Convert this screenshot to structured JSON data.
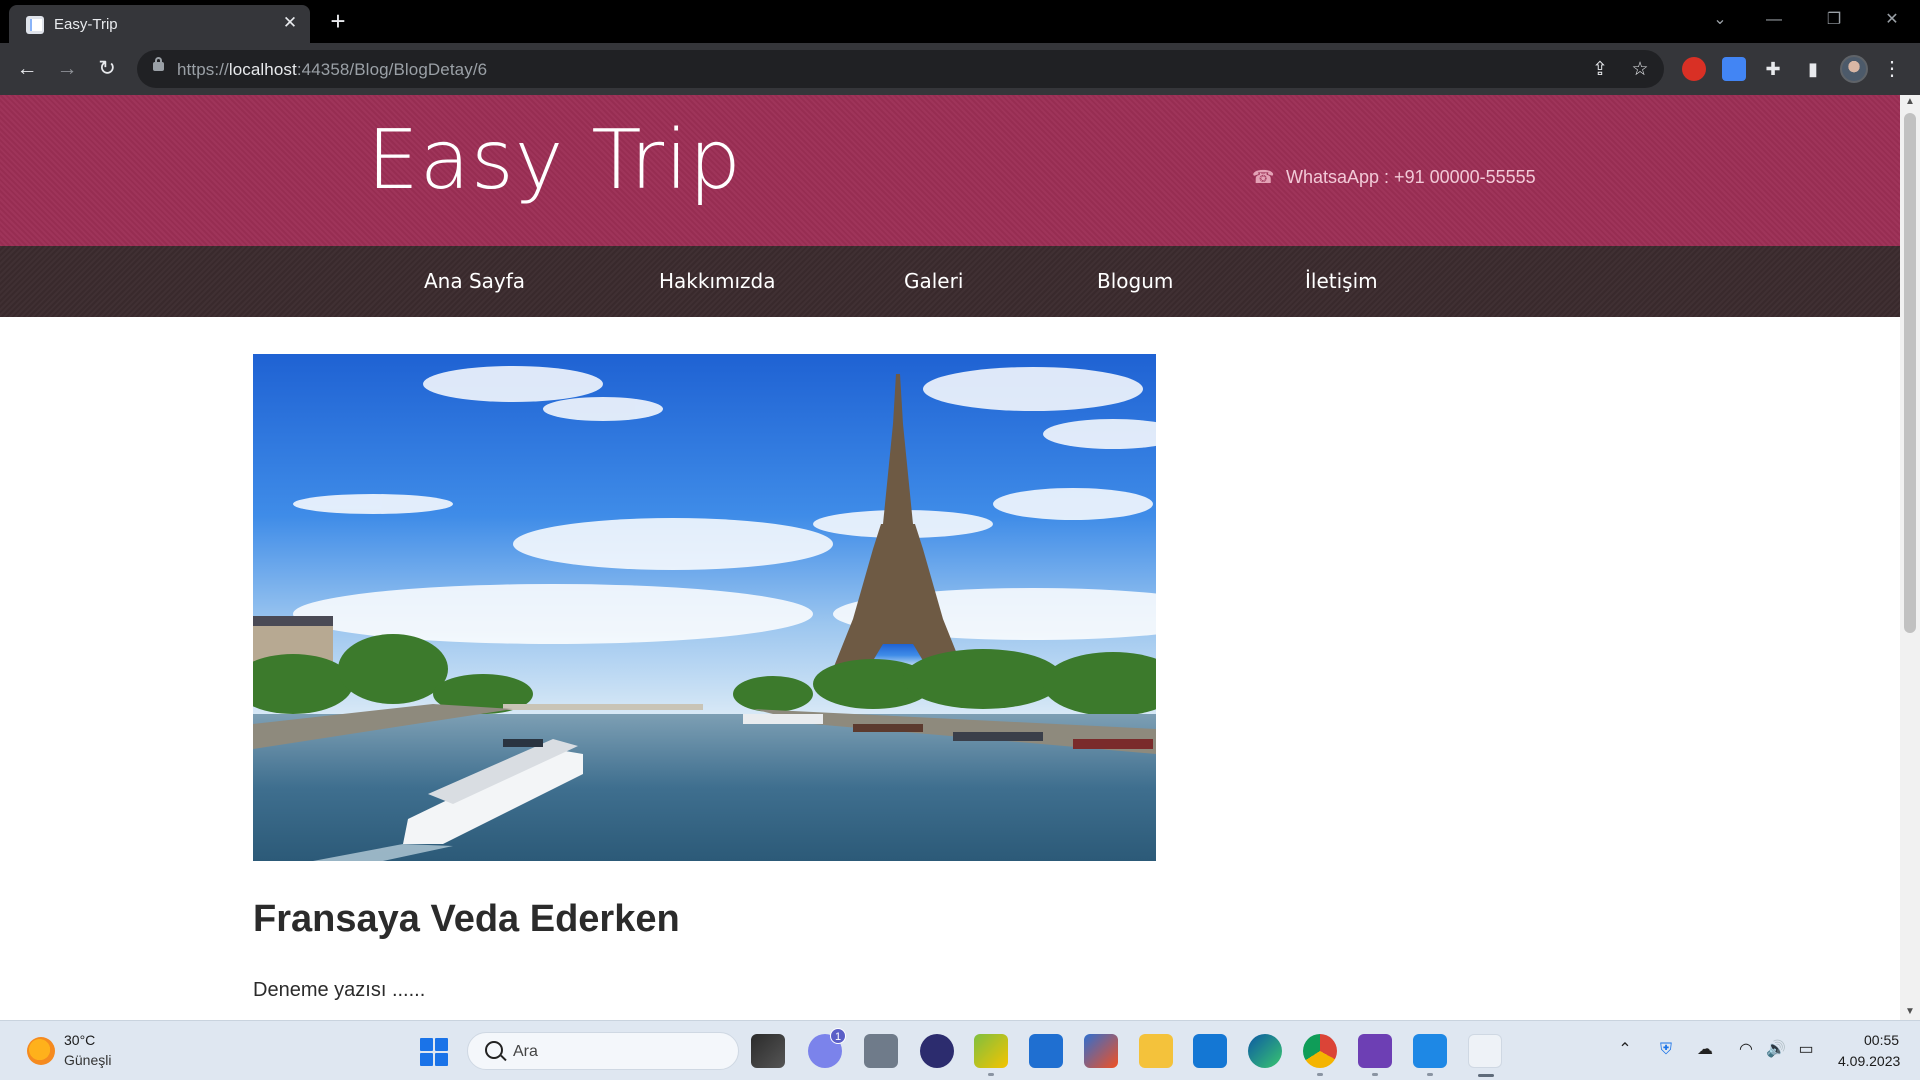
{
  "browser": {
    "tab_title": "Easy-Trip",
    "url_scheme": "https://",
    "url_host": "localhost",
    "url_rest": ":44358/Blog/BlogDetay/6"
  },
  "site": {
    "logo": "Easy Trip",
    "contact": "WhatsaApp : +91 00000-55555",
    "nav": [
      "Ana Sayfa",
      "Hakkımızda",
      "Galeri",
      "Blogum",
      "İletişim"
    ]
  },
  "post": {
    "image_alt": "Eiffel Tower and Seine river with tourist boat",
    "title": "Fransaya Veda Ederken",
    "body": "Deneme yazısı ......"
  },
  "taskbar": {
    "weather_temp": "30°C",
    "weather_desc": "Güneşli",
    "search_placeholder": "Ara",
    "teams_badge": "1",
    "time": "00:55",
    "date": "4.09.2023"
  },
  "colors": {
    "header": "#9c2e55",
    "nav": "#3b2b2e"
  }
}
